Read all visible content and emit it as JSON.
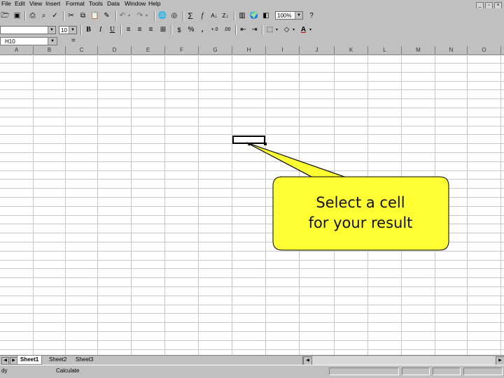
{
  "menu": [
    "File",
    "Edit",
    "View",
    "Insert",
    "Format",
    "Tools",
    "Data",
    "Window",
    "Help"
  ],
  "standard_toolbar": {
    "zoom": "100%"
  },
  "format_toolbar": {
    "font_name": "",
    "font_size": "10",
    "bold": "B",
    "italic": "I",
    "underline": "U",
    "currency": "$",
    "percent": "%",
    "comma": ",",
    "sum": "Σ",
    "function": "f",
    "font_color_letter": "A"
  },
  "formula_bar": {
    "name_box": "H10",
    "equals": "=",
    "formula": ""
  },
  "columns": [
    "A",
    "B",
    "C",
    "D",
    "E",
    "F",
    "G",
    "H",
    "I",
    "J",
    "K",
    "L",
    "M",
    "N",
    "O"
  ],
  "callout": {
    "line1": "Select a cell",
    "line2": "for your result",
    "fill": "#ffff33"
  },
  "sheet_tabs": [
    "Sheet1",
    "Sheet2",
    "Sheet3"
  ],
  "status": {
    "left": "dy",
    "mode": "Calculate"
  }
}
